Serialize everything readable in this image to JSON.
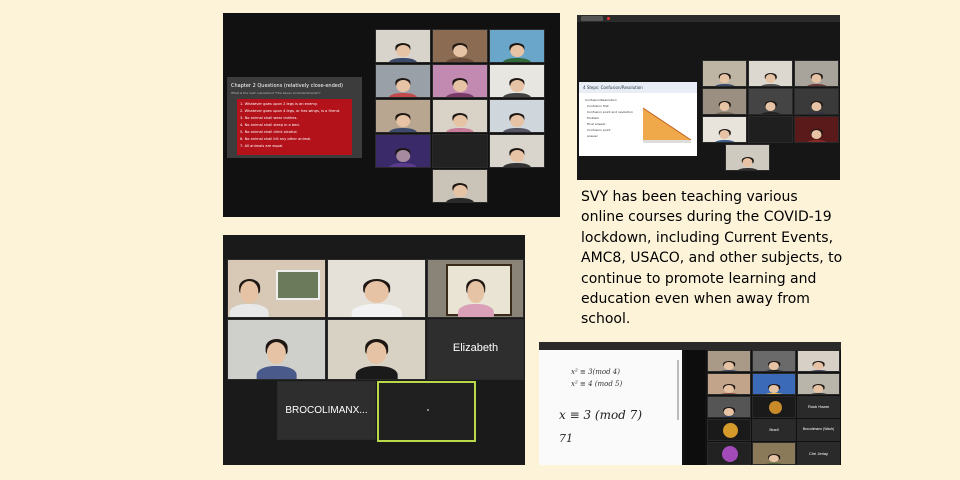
{
  "caption": "SVY has been teaching various online courses during the COVID-19 lockdown, including Current Events, AMC8, USACO, and other subjects, to continue to promote learning and education even when away from school.",
  "screenshot1": {
    "slide_title": "Chapter 2 Questions (relatively close-ended)",
    "slide_subtitle": "What is the next rule behind \"The Seven Commandments\"?",
    "commandments": [
      "1. Whatever goes upon 2 legs is an enemy.",
      "2. Whatever goes upon 4 legs, or has wings, is a friend.",
      "3. No animal shall wear clothes.",
      "4. No animal shall sleep in a bed.",
      "5. No animal shall drink alcohol.",
      "6. No animal shall kill any other animal.",
      "7. All animals are equal."
    ]
  },
  "screenshot2": {
    "slide_title": "4 Steps: Confusion/Resolution",
    "slide_items": [
      "Confusion/Resolution",
      "Confusion first",
      "Confusion point and resolution",
      "Problem",
      "Final answer",
      "Confusion point",
      "answer"
    ]
  },
  "screenshot3": {
    "names": [
      "Elizabeth",
      "BROCOLIMANX..."
    ]
  },
  "screenshot4": {
    "whiteboard_lines": [
      "x² ≡ 3(mod 4)",
      "x² ≡ 4 (mod 5)",
      "x ≡ 3 (mod 7)",
      "71"
    ],
    "participant_names": [
      "Rush Haam",
      "Bradl",
      "Brocolimanx (Wach)",
      "Chri Jeriay"
    ]
  }
}
